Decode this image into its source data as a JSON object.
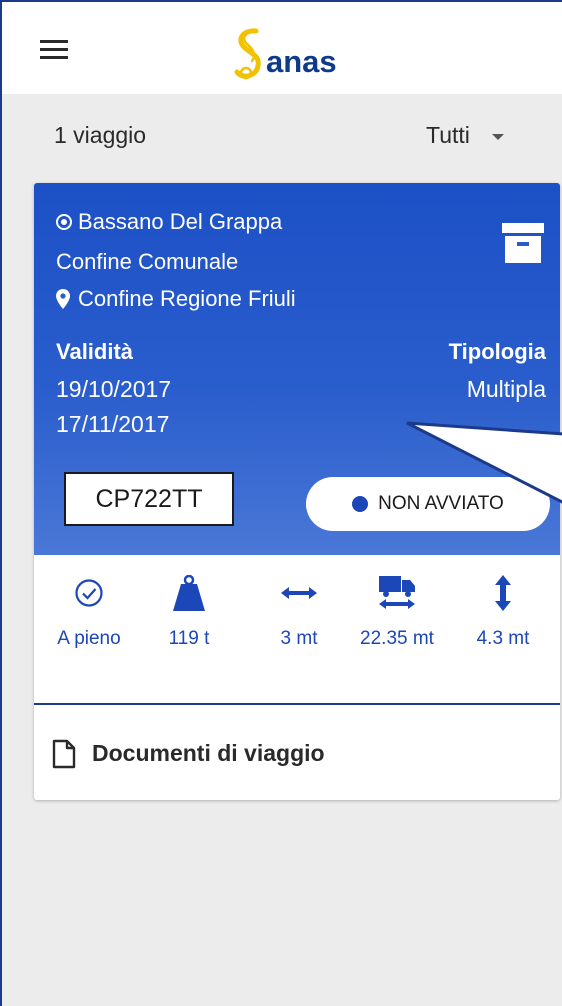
{
  "app": {
    "logo_text": "anas"
  },
  "toolbar": {
    "trip_count": "1 viaggio",
    "filter_value": "Tutti"
  },
  "trip": {
    "origin": "Bassano Del Grappa",
    "origin_detail": "Confine Comunale",
    "destination": "Confine Regione Friuli",
    "validity_label": "Validità",
    "validity_from": "19/10/2017",
    "validity_to": "17/11/2017",
    "type_label": "Tipologia",
    "type_value": "Multipla",
    "plate": "CP722TT",
    "status": "NON AVVIATO",
    "specs": [
      {
        "icon": "check-circle-icon",
        "value": "A pieno"
      },
      {
        "icon": "weight-icon",
        "value": "119 t"
      },
      {
        "icon": "width-arrows-icon",
        "value": "3 mt"
      },
      {
        "icon": "truck-length-icon",
        "value": "22.35 mt"
      },
      {
        "icon": "height-arrows-icon",
        "value": "4.3 mt"
      }
    ],
    "documents_label": "Documenti di viaggio"
  },
  "colors": {
    "brand_blue": "#1c50c6",
    "accent_blue": "#1c47b8",
    "logo_yellow": "#f2c200",
    "logo_navy": "#0e3a8a",
    "background": "#ececec"
  }
}
